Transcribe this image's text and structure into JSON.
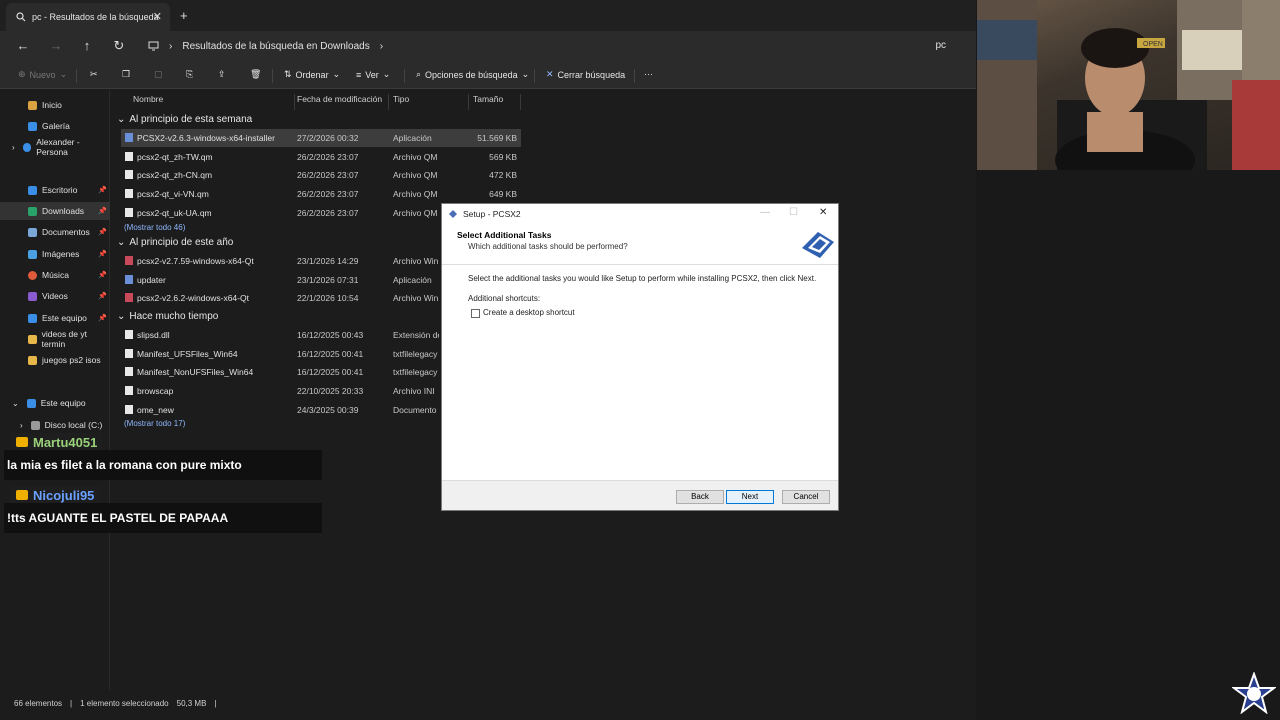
{
  "explorer": {
    "tab_title": "pc - Resultados de la búsqueda",
    "new_tab": "+",
    "address": {
      "path": "Resultados de la búsqueda en Downloads",
      "search_scope": "pc"
    },
    "toolbar": {
      "new": "Nuevo",
      "sort": "Ordenar",
      "view": "Ver",
      "search_options": "Opciones de búsqueda",
      "close_search": "Cerrar búsqueda",
      "more": "···"
    },
    "sidebar": {
      "items": [
        {
          "label": "Inicio",
          "icon": "home-icon",
          "color": "#d9a441"
        },
        {
          "label": "Galería",
          "icon": "gallery-icon",
          "color": "#3a8ee6"
        },
        {
          "label": "Alexander - Persona",
          "icon": "cloud-icon",
          "color": "#3a8ee6"
        },
        {
          "label": "Escritorio",
          "icon": "desktop-icon",
          "color": "#3a8ee6"
        },
        {
          "label": "Downloads",
          "icon": "download-icon",
          "color": "#2aa36b"
        },
        {
          "label": "Documentos",
          "icon": "document-icon",
          "color": "#7aa7d8"
        },
        {
          "label": "Imágenes",
          "icon": "pictures-icon",
          "color": "#4aa0e0"
        },
        {
          "label": "Música",
          "icon": "music-icon",
          "color": "#e05a3a"
        },
        {
          "label": "Videos",
          "icon": "video-icon",
          "color": "#8a5ad0"
        },
        {
          "label": "Este equipo",
          "icon": "pc-icon",
          "color": "#3a8ee6"
        },
        {
          "label": "videos de yt termin",
          "icon": "folder-icon",
          "color": "#e8b74a"
        },
        {
          "label": "juegos ps2 isos",
          "icon": "folder-icon",
          "color": "#e8b74a"
        },
        {
          "label": "Este equipo",
          "icon": "pc-icon",
          "color": "#3a8ee6"
        },
        {
          "label": "Disco local (C:)",
          "icon": "drive-icon",
          "color": "#9a9a9a"
        }
      ]
    },
    "columns": {
      "name": "Nombre",
      "modified": "Fecha de modificación",
      "type": "Tipo",
      "size": "Tamaño"
    },
    "groups": [
      {
        "title": "Al principio de esta semana",
        "show_all": "(Mostrar todo 46)",
        "rows": [
          {
            "name": "PCSX2-v2.6.3-windows-x64-installer",
            "date": "27/2/2026 00:32",
            "type": "Aplicación",
            "size": "51.569 KB"
          },
          {
            "name": "pcsx2-qt_zh-TW.qm",
            "date": "26/2/2026 23:07",
            "type": "Archivo QM",
            "size": "569 KB"
          },
          {
            "name": "pcsx2-qt_zh-CN.qm",
            "date": "26/2/2026 23:07",
            "type": "Archivo QM",
            "size": "472 KB"
          },
          {
            "name": "pcsx2-qt_vi-VN.qm",
            "date": "26/2/2026 23:07",
            "type": "Archivo QM",
            "size": "649 KB"
          },
          {
            "name": "pcsx2-qt_uk-UA.qm",
            "date": "26/2/2026 23:07",
            "type": "Archivo QM",
            "size": ""
          }
        ]
      },
      {
        "title": "Al principio de este año",
        "rows": [
          {
            "name": "pcsx2-v2.7.59-windows-x64-Qt",
            "date": "23/1/2026 14:29",
            "type": "Archivo WinR",
            "size": ""
          },
          {
            "name": "updater",
            "date": "23/1/2026 07:31",
            "type": "Aplicación",
            "size": ""
          },
          {
            "name": "pcsx2-v2.6.2-windows-x64-Qt",
            "date": "22/1/2026 10:54",
            "type": "Archivo WinR",
            "size": ""
          }
        ]
      },
      {
        "title": "Hace mucho tiempo",
        "show_all": "(Mostrar todo 17)",
        "rows": [
          {
            "name": "slipsd.dll",
            "date": "16/12/2025 00:43",
            "type": "Extensión de",
            "size": ""
          },
          {
            "name": "Manifest_UFSFiles_Win64",
            "date": "16/12/2025 00:41",
            "type": "txtfilelegacy",
            "size": ""
          },
          {
            "name": "Manifest_NonUFSFiles_Win64",
            "date": "16/12/2025 00:41",
            "type": "txtfilelegacy",
            "size": ""
          },
          {
            "name": "browscap",
            "date": "22/10/2025 20:33",
            "type": "Archivo INI",
            "size": ""
          },
          {
            "name": "ome_new",
            "date": "24/3/2025 00:39",
            "type": "Documento d",
            "size": ""
          }
        ]
      }
    ],
    "status": {
      "count": "66 elementos",
      "selected": "1 elemento seleccionado",
      "size": "50,3 MB"
    }
  },
  "chat": [
    {
      "user": "Martu4051",
      "color": "#9ad27a",
      "message": "la mia es filet a la romana con pure mixto"
    },
    {
      "user": "Nicojuli95",
      "color": "#6aa0ff",
      "message": "!tts AGUANTE EL PASTEL DE PAPAAA"
    }
  ],
  "dialog": {
    "title": "Setup - PCSX2",
    "heading": "Select Additional Tasks",
    "subheading": "Which additional tasks should be performed?",
    "instruction": "Select the additional tasks you would like Setup to perform while installing PCSX2, then click Next.",
    "group_label": "Additional shortcuts:",
    "checkbox_label": "Create a desktop shortcut",
    "back": "Back",
    "next": "Next",
    "cancel": "Cancel"
  },
  "webcam_sign": "OPEN"
}
